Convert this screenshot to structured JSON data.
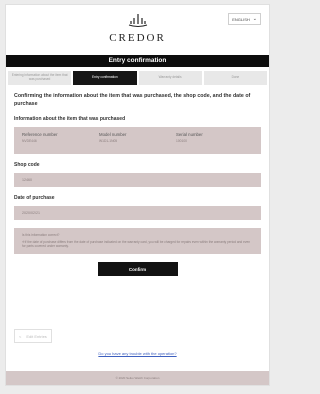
{
  "header": {
    "logo_text": "CREDOR",
    "language": "ENGLISH"
  },
  "title": "Entry confirmation",
  "steps": [
    {
      "label": "Entering information about the item that was purchased"
    },
    {
      "label": "Entry confirmation"
    },
    {
      "label": "Warranty details"
    },
    {
      "label": "Done"
    }
  ],
  "intro": "Confirming the information about the item that was purchased, the shop code, and the date of purchase",
  "item_section": {
    "title": "Information about the item that was purchased",
    "fields": [
      {
        "label": "Reference number",
        "value": "NVDE446"
      },
      {
        "label": "Model number",
        "value": "W1D1-1N05"
      },
      {
        "label": "Serial number",
        "value": "100100"
      }
    ]
  },
  "shop": {
    "title": "Shop code",
    "value": "12460"
  },
  "purchase": {
    "title": "Date of purchase",
    "value": "2020/02/21"
  },
  "notice": {
    "question": "Is this information correct?",
    "text": "※If the date of purchase differs from the date of purchase indicated on the warranty card, you will be charged for repairs even within the warranty period and even for parts covered under warranty."
  },
  "buttons": {
    "confirm": "Confirm",
    "edit": "Edit Entries",
    "edit_icon": "<"
  },
  "help_link": "Do you have any trouble with the operation?",
  "footer": "© 2020 Seiko Watch Corporation",
  "colors": {
    "band": "#d4c7c7",
    "dark": "#121212",
    "link": "#3d5fbf"
  }
}
